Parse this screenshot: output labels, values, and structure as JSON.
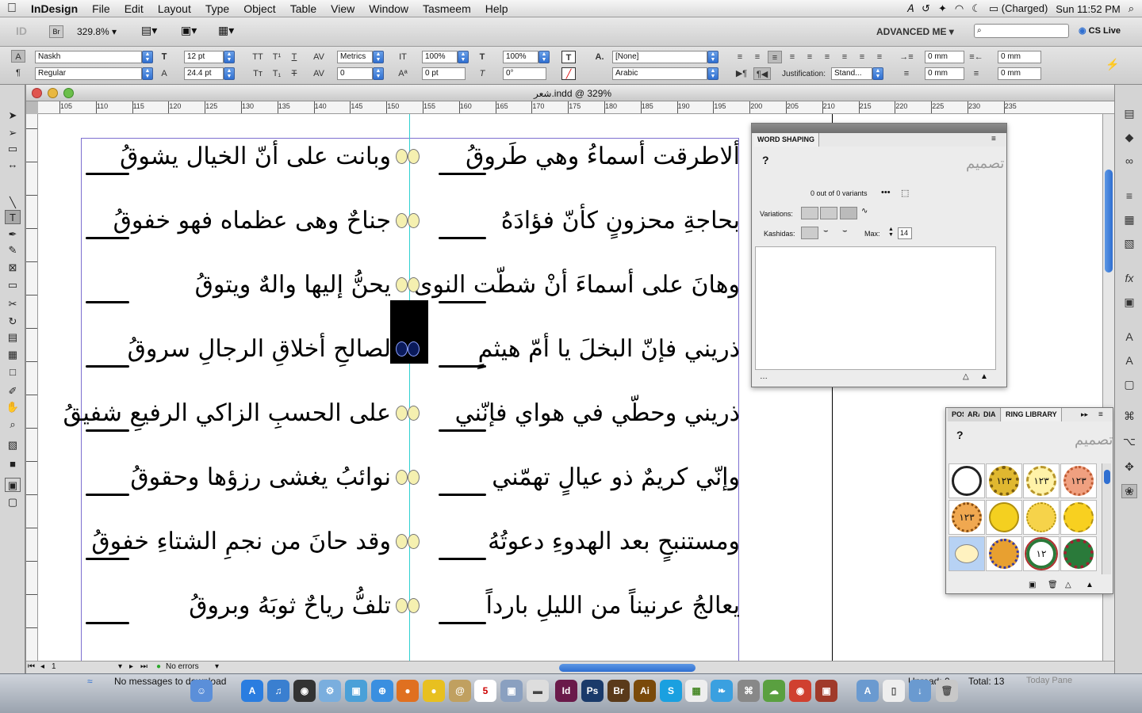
{
  "menubar": {
    "app": "InDesign",
    "items": [
      "File",
      "Edit",
      "Layout",
      "Type",
      "Object",
      "Table",
      "View",
      "Window",
      "Tasmeem",
      "Help"
    ],
    "battery": "(Charged)",
    "clock": "Sun 11:52 PM"
  },
  "appbar": {
    "zoom": "329.8%",
    "workspace": "ADVANCED ME",
    "cs_live": "CS Live",
    "br_label": "Br"
  },
  "control": {
    "font_family": "Naskh",
    "font_style": "Regular",
    "font_size": "12 pt",
    "leading": "24.4 pt",
    "kerning": "Metrics",
    "tracking": "0",
    "vscale": "100%",
    "hscale": "100%",
    "baseline": "0 pt",
    "skew": "0°",
    "char_style": "[None]",
    "language": "Arabic",
    "indent_left": "0 mm",
    "indent_right": "0 mm",
    "space_before": "0 mm",
    "space_after": "0 mm",
    "justification_label": "Justification:",
    "justification": "Stand..."
  },
  "document": {
    "title": "شعر.indd @ 329%",
    "ruler_h": [
      "105",
      "110",
      "115",
      "120",
      "125",
      "130",
      "135",
      "140",
      "145",
      "150",
      "155",
      "160",
      "165",
      "170",
      "175",
      "180",
      "185",
      "190",
      "195",
      "200",
      "205",
      "210",
      "215",
      "220",
      "225",
      "230",
      "235"
    ],
    "lines": [
      {
        "right": "ألاطرقت أسماءُ وهي طَروقُ",
        "left": "وبانت على أنّ الخيال يشوقُ"
      },
      {
        "right": "بحاجةِ محزونٍ كأنّ فؤادَهُ",
        "left": "جناحٌ وهى عظماه فهو خفوقُ"
      },
      {
        "right": "وهانَ على أسماءَ أنْ شطّت النوى",
        "left": "يحنُّ إليها والهٌ ويتوقُ"
      },
      {
        "right": "ذريني فإنّ البخلَ يا أمّ هيثمٍ",
        "left": "لصالحِ أخلاقِ الرجالِ سروقُ"
      },
      {
        "right": "ذريني وحطّي في هواي فإنّني",
        "left": "على الحسبِ الزاكي الرفيعِ شفيقُ"
      },
      {
        "right": "وإنّي كريمٌ ذو عيالٍ تهمّني",
        "left": "نوائبُ يغشى رزؤها وحقوقُ"
      },
      {
        "right": "ومستنبحٍ بعد الهدوءِ دعوتُهُ",
        "left": "وقد حانَ من نجمِ الشتاءِ خفوقُ"
      },
      {
        "right": "يعالجُ عرنيناً من الليلِ بارداً",
        "left": "تلفُّ رياحٌ ثوبَهُ وبروقُ"
      }
    ],
    "page_number": "1",
    "preflight": "No errors"
  },
  "word_shaping": {
    "title": "WORD SHAPING",
    "help": "?",
    "variants": "0 out of 0 variants",
    "variations_label": "Variations:",
    "kashidas_label": "Kashidas:",
    "max_label": "Max:",
    "max_value": "14",
    "logo": "تصميم"
  },
  "ring_library": {
    "tabs": [
      "POS",
      "ARA",
      "DIA",
      "RING LIBRARY"
    ],
    "help": "?",
    "logo": "تصميم",
    "cells": [
      "",
      "١٢٣",
      "١٢٣",
      "١٢٣",
      "١٢٣",
      "",
      "",
      "",
      "",
      "",
      "١٢",
      ""
    ]
  },
  "mail": {
    "message": "No messages to download",
    "unread_label": "Unread:",
    "unread": "0",
    "total_label": "Total:",
    "total": "13",
    "today": "Today Pane"
  },
  "dock_apps": [
    "Id",
    "Ps",
    "Br",
    "Ai",
    "S"
  ],
  "colors": {
    "guide": "#2fd0d0",
    "page_border": "#7d6fd0",
    "selection_accent": "#2f6fd1"
  }
}
